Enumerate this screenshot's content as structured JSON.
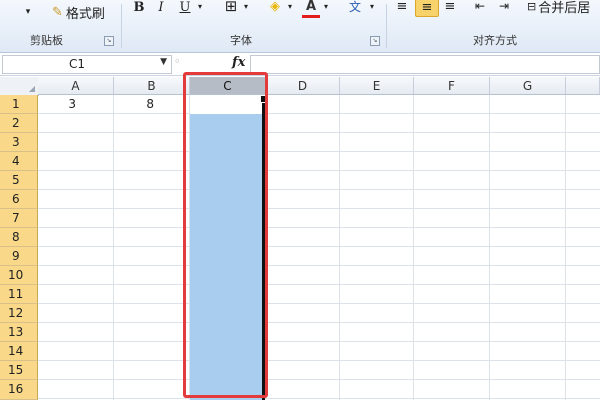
{
  "ribbon": {
    "clipboard": {
      "format_painter_label": "格式刷",
      "group_label": "剪贴板"
    },
    "font": {
      "bold": "B",
      "italic": "I",
      "underline": "U",
      "font_color_glyph": "A",
      "phonetic_glyph": "wén",
      "group_label": "字体"
    },
    "alignment": {
      "merge_center_label": "合并后居",
      "group_label": "对齐方式"
    }
  },
  "formula_bar": {
    "name_box_value": "C1",
    "fx_label": "fx",
    "formula_value": ""
  },
  "columns": [
    "A",
    "B",
    "C",
    "D",
    "E",
    "F",
    "G"
  ],
  "rows": [
    "1",
    "2",
    "3",
    "4",
    "5",
    "6",
    "7",
    "8",
    "9",
    "10",
    "11",
    "12",
    "13",
    "14",
    "15",
    "16"
  ],
  "cells": {
    "A1": "3",
    "B1": "8"
  },
  "selection": {
    "active_cell": "C1",
    "range": "C1:C16",
    "selected_column": "C"
  },
  "colors": {
    "selection_fill": "#a9cdef",
    "row_header_fill": "#f9d989",
    "highlight_box": "#e33b3b"
  }
}
